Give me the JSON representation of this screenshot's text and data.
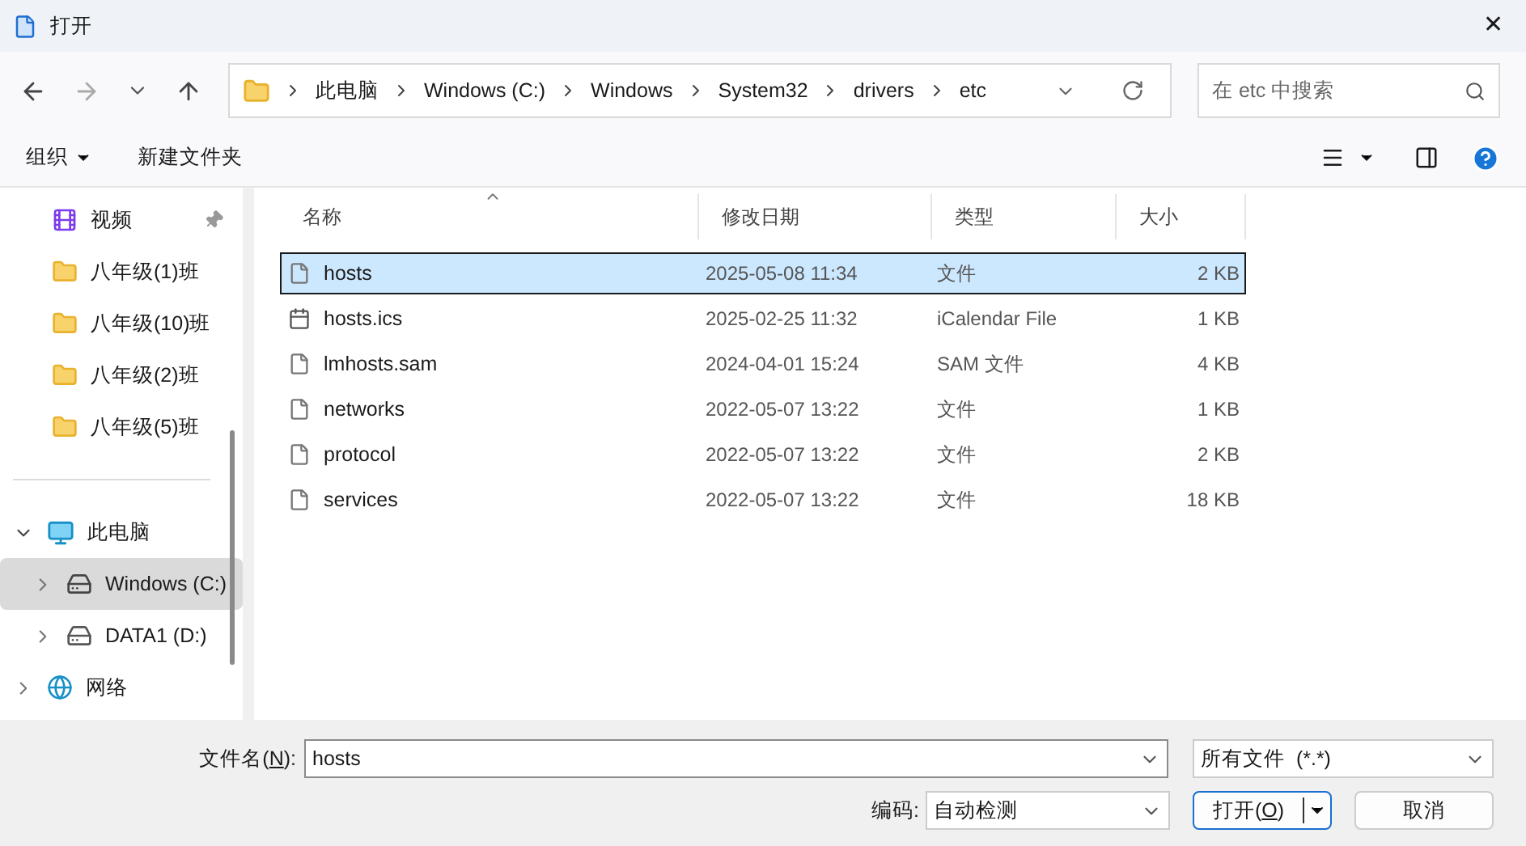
{
  "window": {
    "title": "打开",
    "close": "✕"
  },
  "address": {
    "path": [
      "此电脑",
      "Windows (C:)",
      "Windows",
      "System32",
      "drivers",
      "etc"
    ]
  },
  "search": {
    "placeholder": "在 etc 中搜索"
  },
  "toolbar": {
    "organize": "组织",
    "new_folder": "新建文件夹"
  },
  "sidebar": {
    "items": [
      {
        "label": "视频",
        "kind": "video",
        "pinned": true
      },
      {
        "label": "八年级(1)班",
        "kind": "folder",
        "pinned": false
      },
      {
        "label": "八年级(10)班",
        "kind": "folder",
        "pinned": false
      },
      {
        "label": "八年级(2)班",
        "kind": "folder",
        "pinned": false
      },
      {
        "label": "八年级(5)班",
        "kind": "folder",
        "pinned": false
      }
    ],
    "tree": [
      {
        "label": "此电脑",
        "kind": "pc",
        "expanded": true,
        "selected": false,
        "children": [
          {
            "label": "Windows (C:)",
            "kind": "drive-win",
            "expanded": false,
            "selected": true
          },
          {
            "label": "DATA1 (D:)",
            "kind": "drive",
            "expanded": false,
            "selected": false
          }
        ]
      },
      {
        "label": "网络",
        "kind": "network",
        "expanded": false,
        "selected": false
      }
    ]
  },
  "table": {
    "columns": [
      "名称",
      "修改日期",
      "类型",
      "大小"
    ],
    "rows": [
      {
        "name": "hosts",
        "modified": "2025-05-08 11:34",
        "type": "文件",
        "size": "2 KB",
        "kind": "file",
        "selected": true
      },
      {
        "name": "hosts.ics",
        "modified": "2025-02-25 11:32",
        "type": "iCalendar File",
        "size": "1 KB",
        "kind": "calendar",
        "selected": false
      },
      {
        "name": "lmhosts.sam",
        "modified": "2024-04-01 15:24",
        "type": "SAM 文件",
        "size": "4 KB",
        "kind": "file",
        "selected": false
      },
      {
        "name": "networks",
        "modified": "2022-05-07 13:22",
        "type": "文件",
        "size": "1 KB",
        "kind": "file",
        "selected": false
      },
      {
        "name": "protocol",
        "modified": "2022-05-07 13:22",
        "type": "文件",
        "size": "2 KB",
        "kind": "file",
        "selected": false
      },
      {
        "name": "services",
        "modified": "2022-05-07 13:22",
        "type": "文件",
        "size": "18 KB",
        "kind": "file",
        "selected": false
      }
    ]
  },
  "footer": {
    "filename_label": {
      "before": "文件名(",
      "key": "N",
      "after": "):"
    },
    "filename": "hosts",
    "filetype": "所有文件  (*.*)",
    "encoding_label": "编码:",
    "encoding": "自动检测",
    "open_button": {
      "before": "打开(",
      "key": "O",
      "after": ")"
    },
    "cancel_button": "取消"
  }
}
